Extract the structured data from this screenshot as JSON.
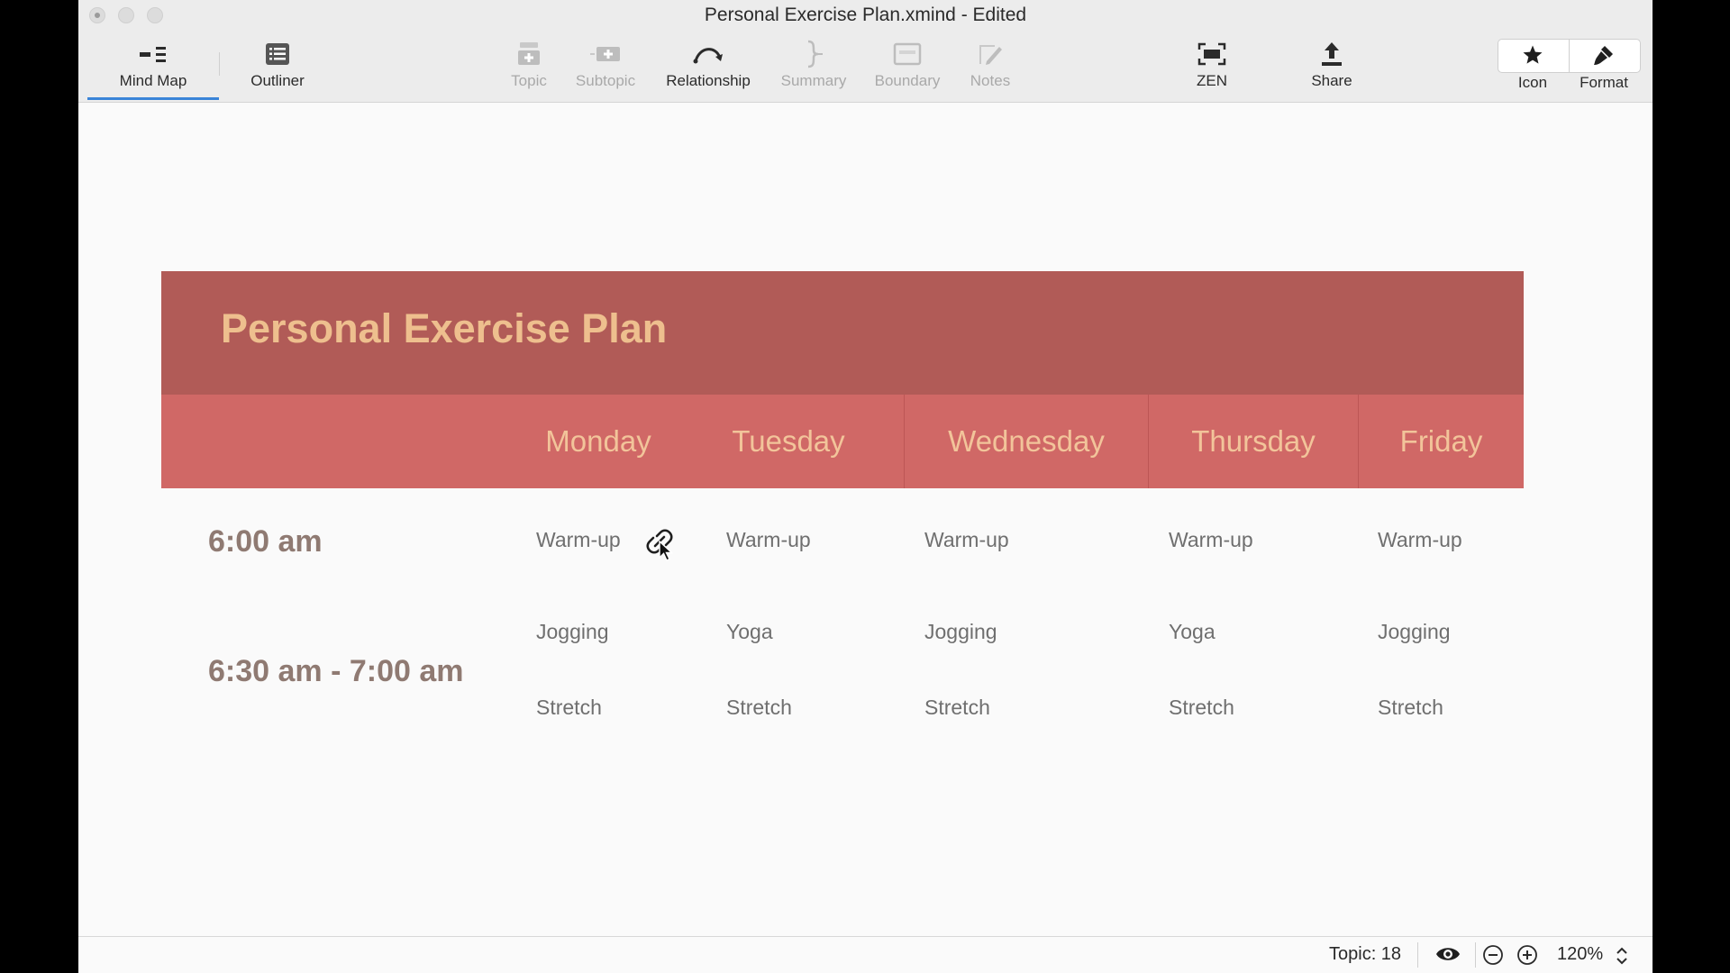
{
  "window": {
    "title": "Personal Exercise Plan.xmind - Edited"
  },
  "toolbar": {
    "view_tabs": [
      {
        "label": "Mind Map",
        "icon": "mindmap-icon",
        "active": true
      },
      {
        "label": "Outliner",
        "icon": "outliner-icon",
        "active": false
      }
    ],
    "insert_buttons": [
      {
        "label": "Topic",
        "icon": "topic-icon",
        "enabled": false
      },
      {
        "label": "Subtopic",
        "icon": "subtopic-icon",
        "enabled": false
      },
      {
        "label": "Relationship",
        "icon": "relationship-icon",
        "enabled": true
      },
      {
        "label": "Summary",
        "icon": "summary-icon",
        "enabled": false
      },
      {
        "label": "Boundary",
        "icon": "boundary-icon",
        "enabled": false
      },
      {
        "label": "Notes",
        "icon": "notes-icon",
        "enabled": false
      }
    ],
    "zen": {
      "label": "ZEN",
      "icon": "zen-icon"
    },
    "share": {
      "label": "Share",
      "icon": "share-icon"
    },
    "panels": [
      {
        "label": "Icon",
        "icon": "star-icon"
      },
      {
        "label": "Format",
        "icon": "brush-icon"
      }
    ]
  },
  "sheet": {
    "title": "Personal Exercise Plan",
    "days": [
      "Monday",
      "Tuesday",
      "Wednesday",
      "Thursday",
      "Friday"
    ],
    "times": [
      "6:00 am",
      "6:30 am - 7:00 am"
    ],
    "rows": {
      "warmup": [
        "Warm-up",
        "Warm-up",
        "Warm-up",
        "Warm-up",
        "Warm-up"
      ],
      "exercise": [
        "Jogging",
        "Yoga",
        "Jogging",
        "Yoga",
        "Jogging"
      ],
      "stretch": [
        "Stretch",
        "Stretch",
        "Stretch",
        "Stretch",
        "Stretch"
      ]
    },
    "colors": {
      "banner": "#b15b57",
      "banner_text": "#eebf8e",
      "day_row": "#d06866",
      "day_text": "#f2c49a",
      "time_text": "#8f7a72"
    }
  },
  "statusbar": {
    "topic_count": "Topic: 18",
    "zoom": "120%"
  }
}
